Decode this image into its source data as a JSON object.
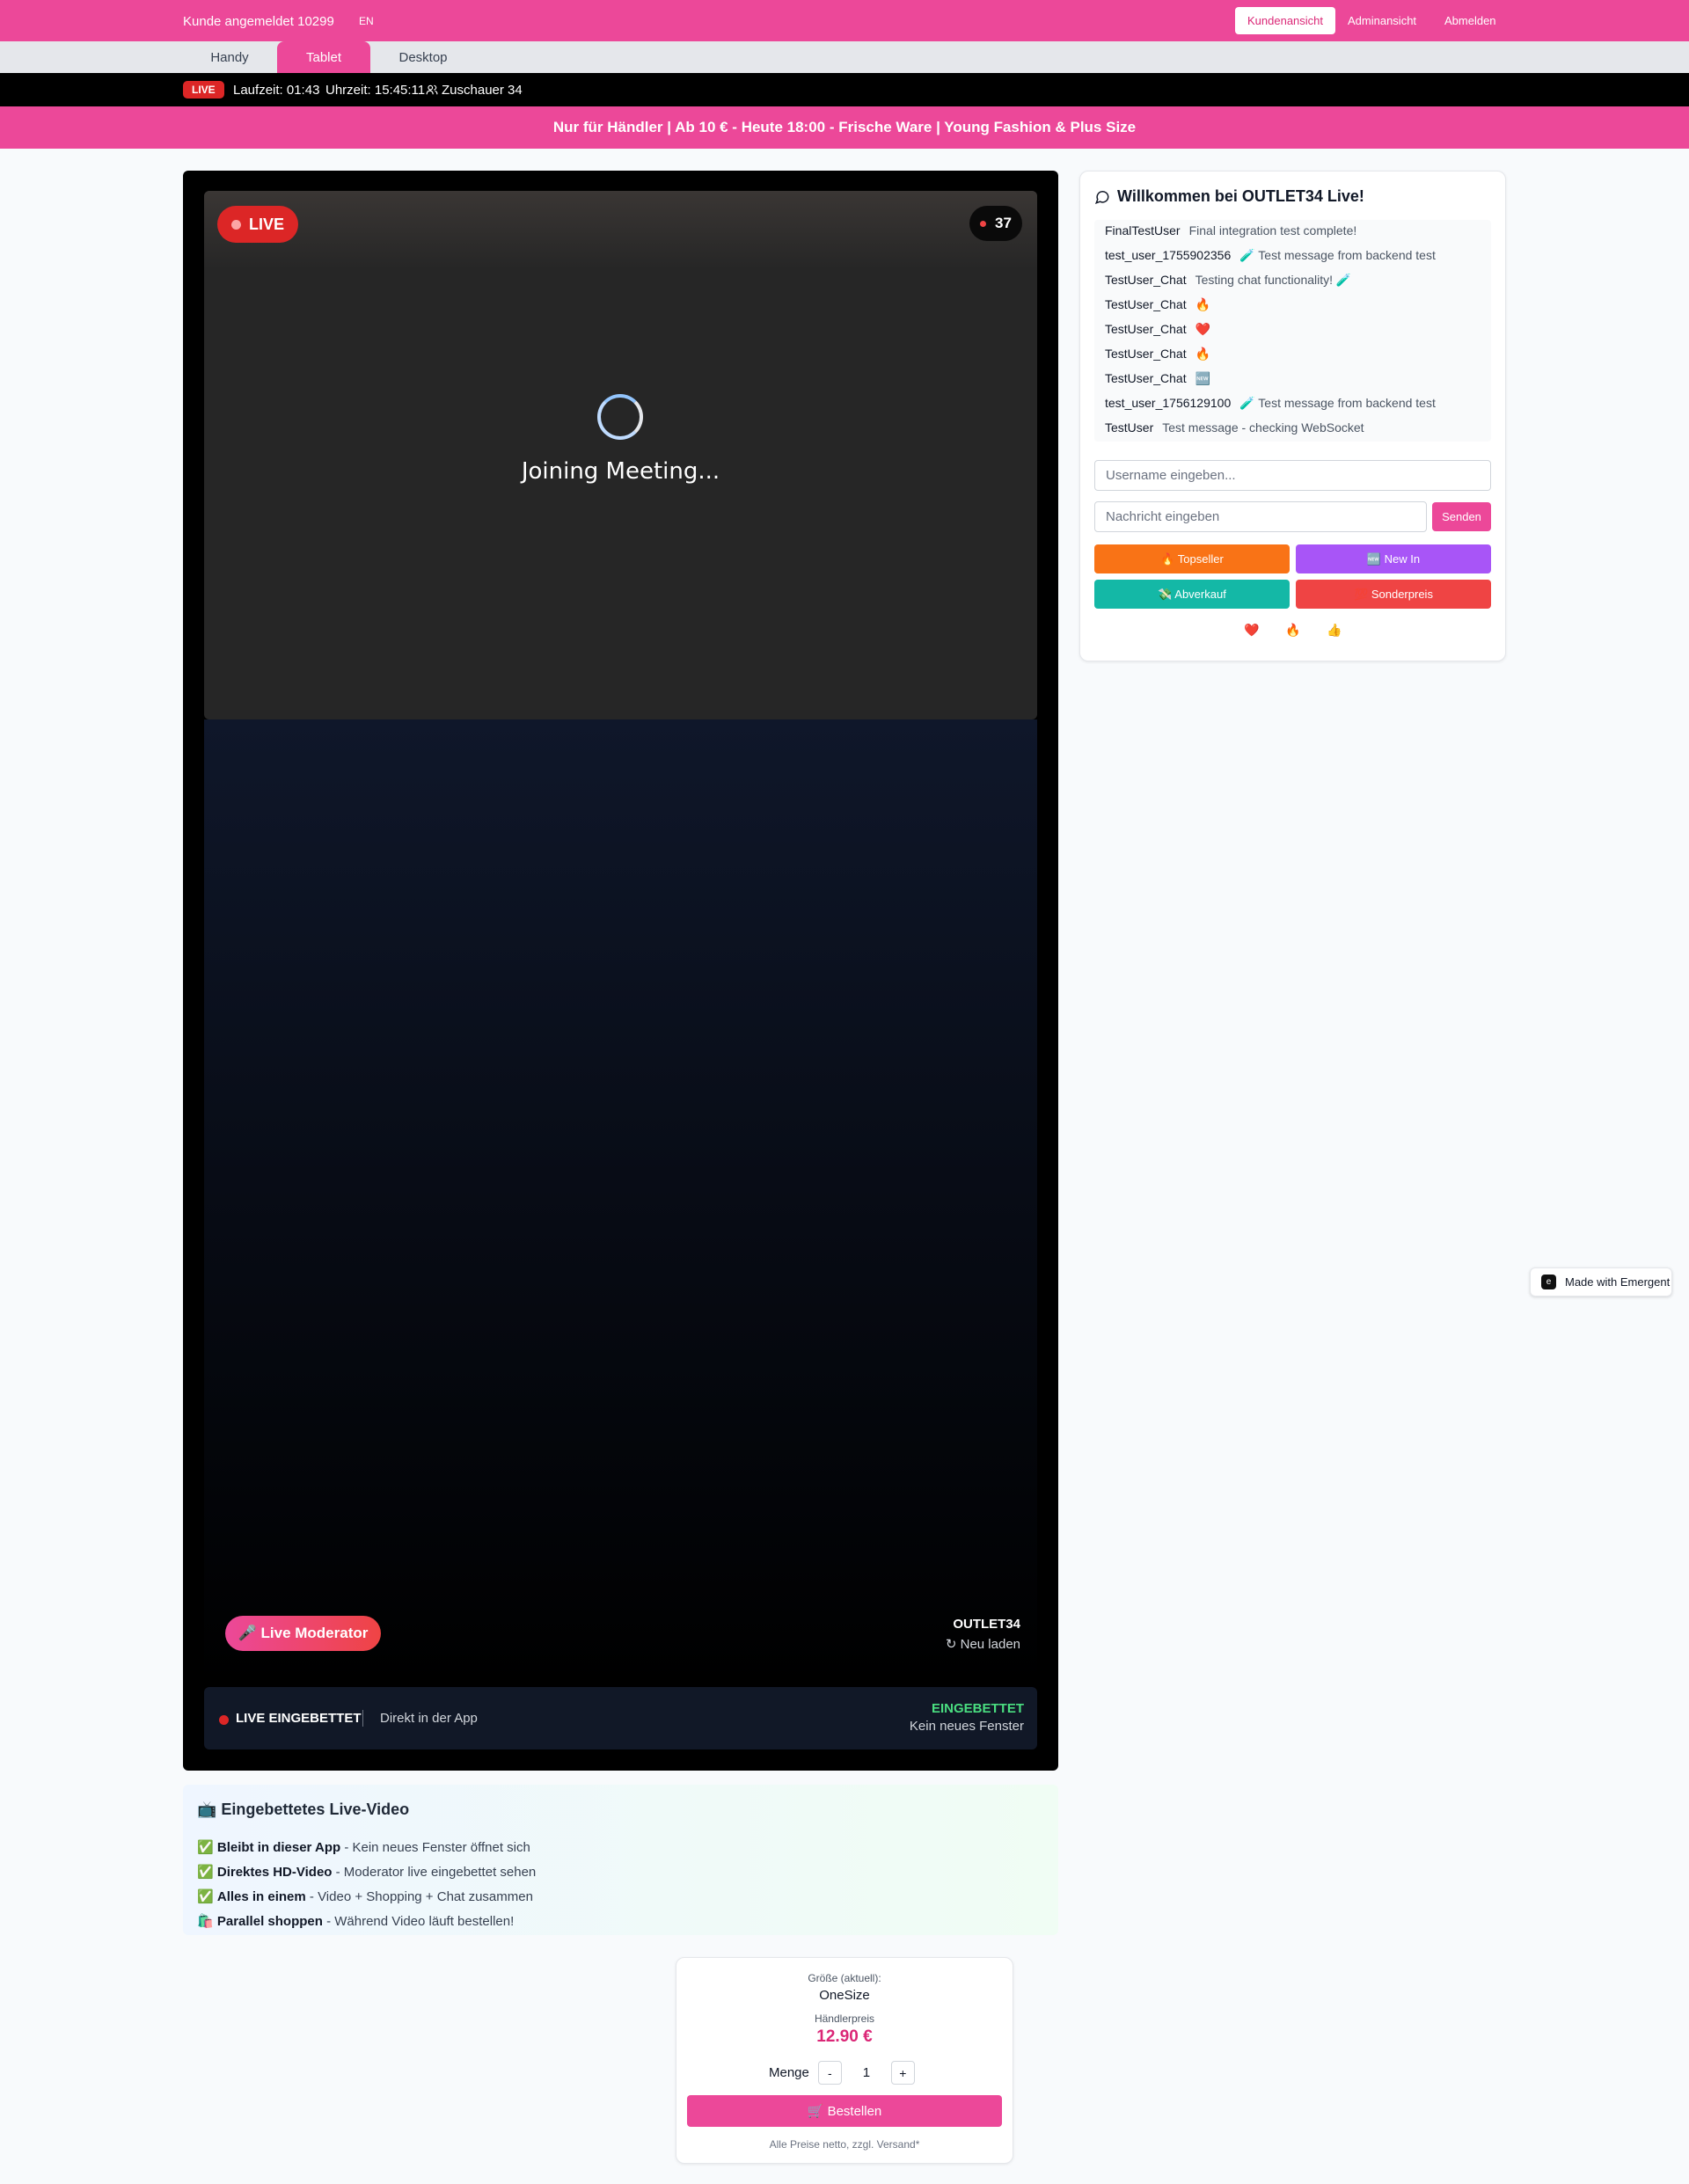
{
  "header": {
    "user_text": "Kunde angemeldet 10299",
    "lang": "EN",
    "nav": [
      "Kundenansicht",
      "Adminansicht",
      "Abmelden"
    ]
  },
  "device_tabs": [
    "Handy",
    "Tablet",
    "Desktop"
  ],
  "active_device_tab": "Tablet",
  "status_bar": {
    "live": "LIVE",
    "runtime": "Laufzeit: 01:43",
    "clock": "Uhrzeit: 15:45:11",
    "viewers": "Zuschauer 34"
  },
  "promo": "Nur für Händler | Ab 10 € - Heute 18:00 - Frische Ware | Young Fashion & Plus Size",
  "video": {
    "live_label": "LIVE",
    "viewer_count": "37",
    "loading_text": "Joining Meeting...",
    "moderator_label": "🎤 Live Moderator",
    "brand": "OUTLET34",
    "reload": "↻ Neu laden",
    "embed_left": "LIVE EINGEBETTET",
    "embed_mid": "Direkt in der App",
    "embed_right_title": "EINGEBETTET",
    "embed_right_sub": "Kein neues Fenster"
  },
  "info": {
    "title": "📺 Eingebettetes Live-Video",
    "rows": [
      {
        "icon": "✅",
        "bold": "Bleibt in dieser App",
        "text": " - Kein neues Fenster öffnet sich"
      },
      {
        "icon": "✅",
        "bold": "Direktes HD-Video",
        "text": " - Moderator live eingebettet sehen"
      },
      {
        "icon": "✅",
        "bold": "Alles in einem",
        "text": " - Video + Shopping + Chat zusammen"
      },
      {
        "icon": "🛍️",
        "bold": "Parallel shoppen",
        "text": " - Während Video läuft bestellen!"
      }
    ]
  },
  "chat": {
    "title": "Willkommen bei OUTLET34 Live!",
    "messages": [
      {
        "user": "FinalTestUser",
        "text": "Final integration test complete!"
      },
      {
        "user": "test_user_1755902356",
        "text": "🧪 Test message from backend test"
      },
      {
        "user": "TestUser_Chat",
        "text": "Testing chat functionality! 🧪"
      },
      {
        "user": "TestUser_Chat",
        "text": "🔥"
      },
      {
        "user": "TestUser_Chat",
        "text": "❤️"
      },
      {
        "user": "TestUser_Chat",
        "text": "🔥"
      },
      {
        "user": "TestUser_Chat",
        "text": "🆕"
      },
      {
        "user": "test_user_1756129100",
        "text": "🧪 Test message from backend test"
      },
      {
        "user": "TestUser",
        "text": "Test message - checking WebSocket"
      }
    ],
    "username_placeholder": "Username eingeben...",
    "message_placeholder": "Nachricht eingeben",
    "send_label": "Senden",
    "quick_buttons": [
      {
        "label": "🔥 Topseller",
        "color": "#f97316"
      },
      {
        "label": "🆕 New In",
        "color": "#a855f7"
      },
      {
        "label": "💸 Abverkauf",
        "color": "#14b8a6"
      },
      {
        "label": "💯 Sonderpreis",
        "color": "#ef4444"
      }
    ],
    "reactions": [
      "❤️",
      "🔥",
      "👍"
    ]
  },
  "made_with": "Made with Emergent",
  "order": {
    "size_label": "Größe (aktuell):",
    "size_value": "OneSize",
    "price_label": "Händlerpreis",
    "price": "12.90 €",
    "qty_label": "Menge",
    "minus": "-",
    "qty": "1",
    "plus": "+",
    "buy_label": "🛒 Bestellen",
    "footnote": "Alle Preise netto, zzgl. Versand*"
  },
  "colors": {
    "brand_pink": "#ec4899",
    "live_red": "#dc2626",
    "embedded_green": "#4ade80"
  }
}
